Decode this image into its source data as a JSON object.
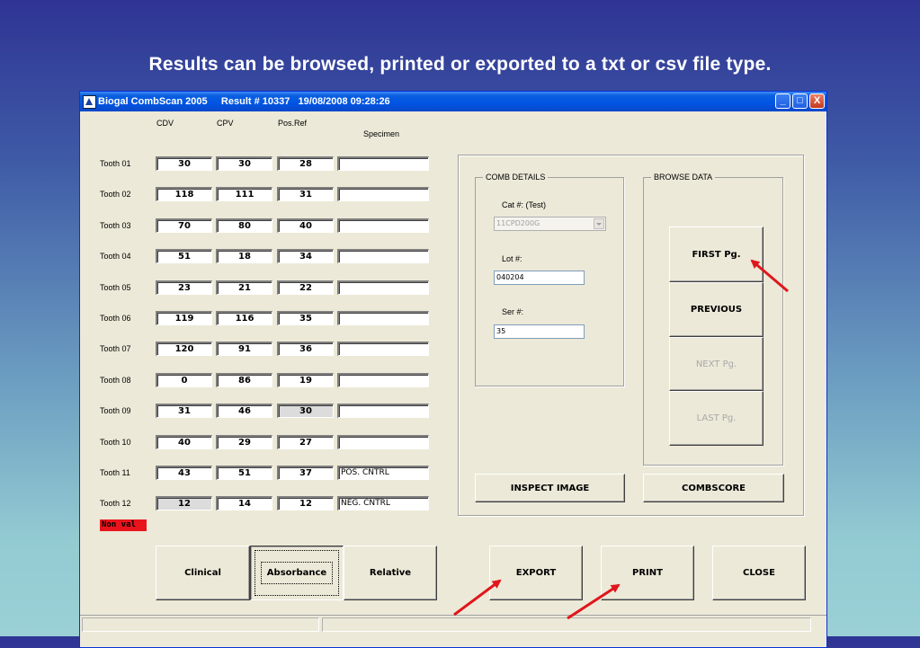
{
  "slide_title": "Results can be browsed, printed or exported to a txt or csv file type.",
  "window": {
    "title": "Biogal CombScan 2005     Result # 10337   19/08/2008 09:28:26",
    "buttons": {
      "minimize": "_",
      "maximize": "□",
      "close": "X"
    }
  },
  "columns": {
    "cdv": "CDV",
    "cpv": "CPV",
    "posref": "Pos.Ref",
    "specimen": "Specimen"
  },
  "rows": [
    {
      "label": "Tooth 01",
      "cdv": "30",
      "cpv": "30",
      "posref": "28",
      "specimen": ""
    },
    {
      "label": "Tooth 02",
      "cdv": "118",
      "cpv": "111",
      "posref": "31",
      "specimen": ""
    },
    {
      "label": "Tooth 03",
      "cdv": "70",
      "cpv": "80",
      "posref": "40",
      "specimen": ""
    },
    {
      "label": "Tooth 04",
      "cdv": "51",
      "cpv": "18",
      "posref": "34",
      "specimen": ""
    },
    {
      "label": "Tooth 05",
      "cdv": "23",
      "cpv": "21",
      "posref": "22",
      "specimen": ""
    },
    {
      "label": "Tooth 06",
      "cdv": "119",
      "cpv": "116",
      "posref": "35",
      "specimen": ""
    },
    {
      "label": "Tooth 07",
      "cdv": "120",
      "cpv": "91",
      "posref": "36",
      "specimen": ""
    },
    {
      "label": "Tooth 08",
      "cdv": "0",
      "cpv": "86",
      "posref": "19",
      "specimen": ""
    },
    {
      "label": "Tooth 09",
      "cdv": "31",
      "cpv": "46",
      "posref": "30",
      "specimen": ""
    },
    {
      "label": "Tooth 10",
      "cdv": "40",
      "cpv": "29",
      "posref": "27",
      "specimen": ""
    },
    {
      "label": "Tooth 11",
      "cdv": "43",
      "cpv": "51",
      "posref": "37",
      "specimen": "POS. CNTRL"
    },
    {
      "label": "Tooth 12",
      "cdv": "12",
      "cpv": "14",
      "posref": "12",
      "specimen": "NEG. CNTRL"
    }
  ],
  "non_valid_badge": "Non val",
  "comb_details": {
    "legend": "COMB DETAILS",
    "cat_label": "Cat #: (Test)",
    "cat_value": "11CPD200G",
    "lot_label": "Lot #:",
    "lot_value": "040204",
    "ser_label": "Ser #:",
    "ser_value": "35"
  },
  "browse_data": {
    "legend": "BROWSE DATA",
    "first": "FIRST Pg.",
    "previous": "PREVIOUS",
    "next": "NEXT Pg.",
    "last": "LAST Pg."
  },
  "inspect_image": "INSPECT IMAGE",
  "combscore": "COMBSCORE",
  "mode_buttons": {
    "clinical": "Clinical",
    "absorbance": "Absorbance",
    "relative": "Relative"
  },
  "actions": {
    "export": "EXPORT",
    "print": "PRINT",
    "close": "CLOSE"
  },
  "colors": {
    "arrow": "#e0161c",
    "non_val_bg": "#e8141c",
    "titlebar": "#0054e3"
  }
}
